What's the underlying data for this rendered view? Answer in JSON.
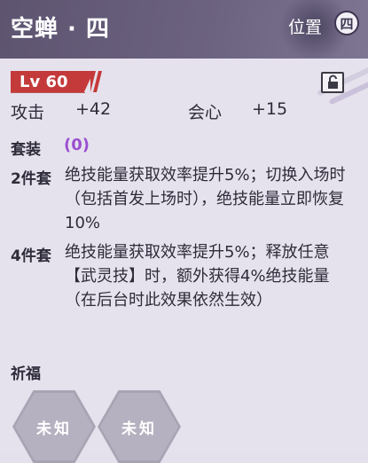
{
  "header": {
    "title": "空蝉 · 四",
    "position_label": "位置",
    "position_badge": "四"
  },
  "level": {
    "label": "Lv 60",
    "value": 60
  },
  "stats": [
    {
      "label": "攻击",
      "value": "+42"
    },
    {
      "label": "会心",
      "value": "+15"
    }
  ],
  "set": {
    "title": "套装",
    "count": "(0)",
    "bonuses": [
      {
        "label": "2件套",
        "text": "绝技能量获取效率提升5%；切换入场时（包括首发上场时），绝技能量立即恢复10%"
      },
      {
        "label": "4件套",
        "text": "绝技能量获取效率提升5%；释放任意【武灵技】时，额外获得4%绝技能量（在后台时此效果依然生效）"
      }
    ]
  },
  "blessing": {
    "title": "祈福",
    "slots": [
      "未知",
      "未知"
    ]
  },
  "icons": {
    "lock": "lock-icon",
    "level_stripes": "stripe-icon"
  },
  "colors": {
    "header": "#6b6280",
    "level_badge": "#c43a3a",
    "set_count": "#9a4fd0",
    "unknown_slot": "#a9a4b4"
  }
}
